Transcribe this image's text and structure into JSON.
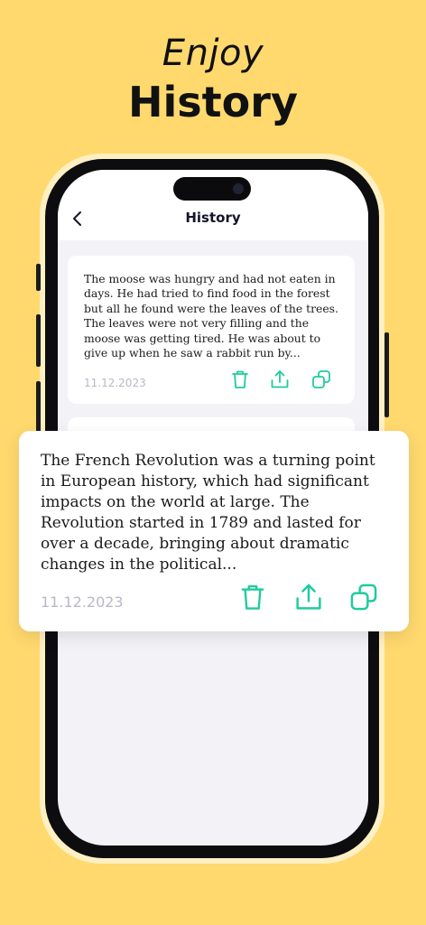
{
  "hero": {
    "line1": "Enjoy",
    "line2": "History"
  },
  "app": {
    "nav_title": "History",
    "icons": {
      "back": "chevron-left-icon",
      "delete": "trash-icon",
      "share": "share-icon",
      "copy": "copy-icon"
    },
    "accent_color": "#1FCB9E"
  },
  "history_items": [
    {
      "text": "The moose was hungry and had not eaten in days. He had tried to find food in the forest but all he found were the leaves of the trees. The leaves were not very filling and the moose was getting tired. He was about to give up when he saw a rabbit run by...",
      "date": "11.12.2023"
    },
    {
      "text": "The French Revolution was a turning point in European history, which had significant impacts on the world at large. The Revolution started in 1789 and lasted for over a decade, bringing about dramatic changes in the political...",
      "date": "11.12.2023"
    }
  ]
}
